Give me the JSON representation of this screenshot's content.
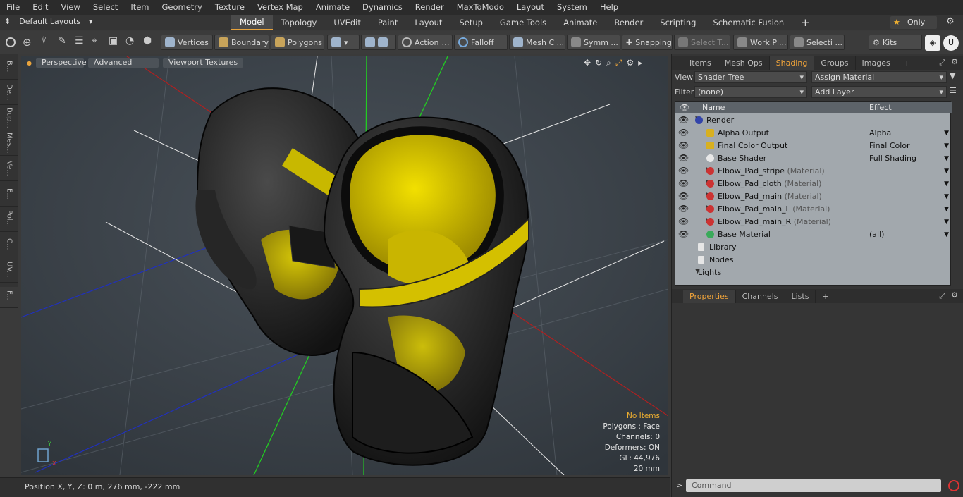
{
  "menubar": {
    "items": [
      "File",
      "Edit",
      "View",
      "Select",
      "Item",
      "Geometry",
      "Texture",
      "Vertex Map",
      "Animate",
      "Dynamics",
      "Render",
      "MaxToModo",
      "Layout",
      "System",
      "Help"
    ]
  },
  "layoutbar": {
    "layout_label": "Default Layouts",
    "tabs": [
      "Model",
      "Topology",
      "UVEdit",
      "Paint",
      "Layout",
      "Setup",
      "Game Tools",
      "Animate",
      "Render",
      "Scripting",
      "Schematic Fusion"
    ],
    "active_tab": "Model",
    "add_label": "+",
    "only_label": "Only"
  },
  "toolbar": {
    "vertices": "Vertices",
    "boundary": "Boundary",
    "polygons": "Polygons",
    "action": "Action",
    "falloff": "Falloff",
    "mesh": "Mesh C ...",
    "symm": "Symm ...",
    "snapping": "Snapping",
    "select_t": "Select T...",
    "work_pl": "Work Pl...",
    "selecti": "Selecti ...",
    "kits": "Kits"
  },
  "lefttabs": [
    "B...",
    "De...",
    "Dup...",
    "Mes...",
    "Ve...",
    "E...",
    "Pol...",
    "C...",
    "UV...",
    "F..."
  ],
  "viewport": {
    "header": {
      "perspective": "Perspective",
      "advanced": "Advanced",
      "textures": "Viewport Textures"
    },
    "info": {
      "no_items": "No Items",
      "polygons": "Polygons : Face",
      "channels": "Channels: 0",
      "deformers": "Deformers: ON",
      "gl": "GL: 44,976",
      "scale": "20 mm"
    }
  },
  "statusbar": {
    "position": "Position X, Y, Z:   0 m, 276 mm, -222 mm"
  },
  "rightpanel": {
    "tabs": [
      "Items",
      "Mesh Ops",
      "Shading",
      "Groups",
      "Images"
    ],
    "active_tab": "Shading",
    "add_label": "+",
    "view_label": "View",
    "view_value": "Shader Tree",
    "assign_value": "Assign Material",
    "filter_label": "Filter",
    "filter_value": "(none)",
    "addlayer_value": "Add Layer",
    "tree": {
      "col_name": "Name",
      "col_effect": "Effect",
      "rows": [
        {
          "name": "Render",
          "dim": "",
          "effect": ""
        },
        {
          "name": "Alpha Output",
          "dim": "",
          "effect": "Alpha"
        },
        {
          "name": "Final Color Output",
          "dim": "",
          "effect": "Final Color"
        },
        {
          "name": "Base Shader",
          "dim": "",
          "effect": "Full Shading"
        },
        {
          "name": "Elbow_Pad_stripe ",
          "dim": "(Material)",
          "effect": ""
        },
        {
          "name": "Elbow_Pad_cloth ",
          "dim": "(Material)",
          "effect": ""
        },
        {
          "name": "Elbow_Pad_main ",
          "dim": "(Material)",
          "effect": ""
        },
        {
          "name": "Elbow_Pad_main_L ",
          "dim": "(Material)",
          "effect": ""
        },
        {
          "name": "Elbow_Pad_main_R ",
          "dim": "(Material)",
          "effect": ""
        },
        {
          "name": "Base Material",
          "dim": "",
          "effect": "(all)"
        },
        {
          "name": "Library",
          "dim": "",
          "effect": ""
        },
        {
          "name": "Nodes",
          "dim": "",
          "effect": ""
        },
        {
          "name": "Lights",
          "dim": "",
          "effect": ""
        }
      ]
    },
    "props_tabs": [
      "Properties",
      "Channels",
      "Lists"
    ],
    "props_active": "Properties",
    "command_placeholder": "Command"
  }
}
